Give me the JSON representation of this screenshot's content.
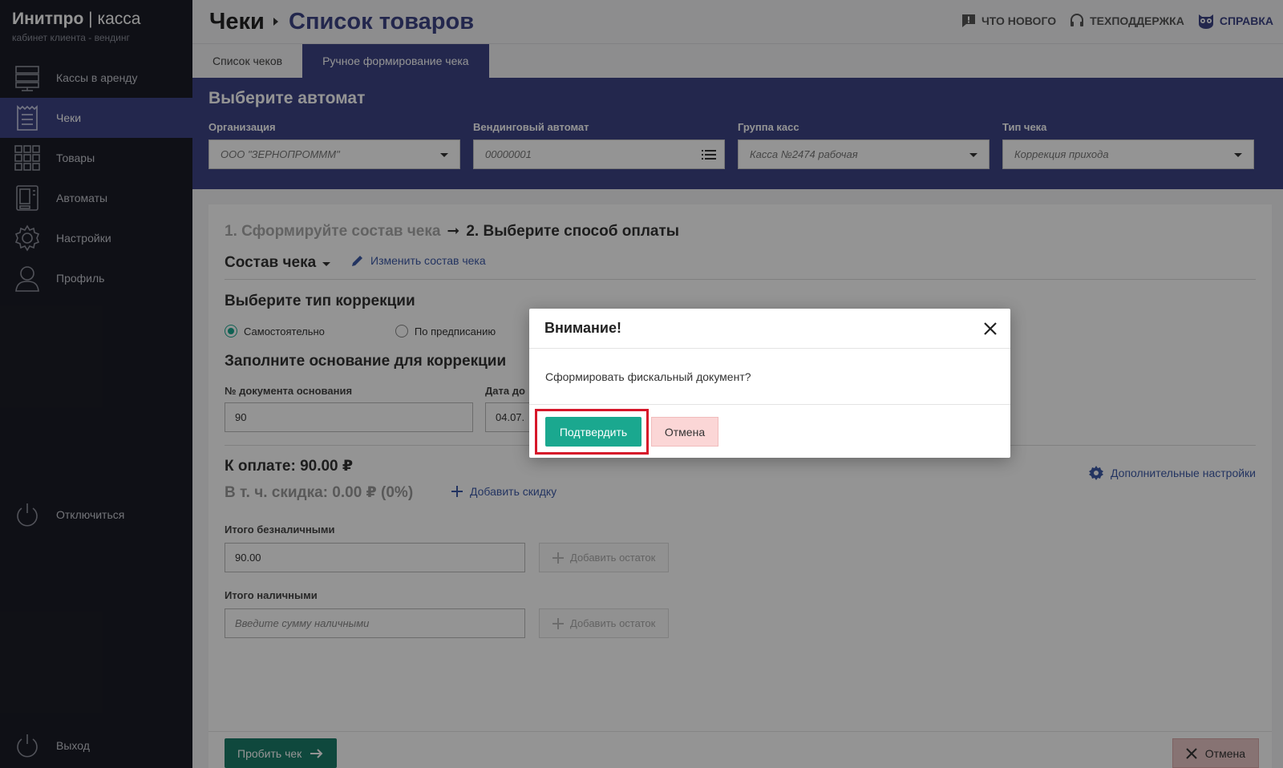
{
  "brand": {
    "name": "Инитпро",
    "separator": "|",
    "product": "касса",
    "subtitle": "кабинет клиента - вендинг"
  },
  "sidebar": {
    "items": [
      {
        "label": "Кассы в аренду",
        "icon": "server-icon"
      },
      {
        "label": "Чеки",
        "icon": "receipt-icon",
        "active": true
      },
      {
        "label": "Товары",
        "icon": "grid-icon"
      },
      {
        "label": "Автоматы",
        "icon": "vending-machine-icon"
      },
      {
        "label": "Настройки",
        "icon": "gear-icon"
      },
      {
        "label": "Профиль",
        "icon": "user-icon"
      }
    ],
    "disconnect": "Отключиться",
    "logout": "Выход"
  },
  "header": {
    "crumb_root": "Чеки",
    "crumb_current": "Список товаров",
    "links": {
      "whats_new": "ЧТО НОВОГО",
      "support": "ТЕХПОДДЕРЖКА",
      "help": "СПРАВКА"
    }
  },
  "tabs": [
    {
      "label": "Список чеков"
    },
    {
      "label": "Ручное формирование чека",
      "active": true
    }
  ],
  "filters": {
    "title": "Выберите автомат",
    "organization": {
      "label": "Организация",
      "value": "ООО \"ЗЕРНОПРОМММ\""
    },
    "machine": {
      "label": "Вендинговый автомат",
      "value": "00000001"
    },
    "group": {
      "label": "Группа касс",
      "value": "Касса №2474 рабочая"
    },
    "receipt_type": {
      "label": "Тип чека",
      "value": "Коррекция прихода"
    }
  },
  "main": {
    "step1": "1. Сформируйте состав чека",
    "step_arrow": "➞",
    "step2": "2. Выберите способ оплаты",
    "composition": "Состав чека",
    "edit_composition": "Изменить состав чека",
    "correction_title": "Выберите тип коррекции",
    "correction_options": [
      {
        "label": "Самостоятельно",
        "selected": true
      },
      {
        "label": "По предписанию",
        "selected": false
      }
    ],
    "basis_title": "Заполните основание для коррекции",
    "doc_number_label": "№ документа основания",
    "doc_number_value": "90",
    "date_label": "Дата до",
    "date_value": "04.07.",
    "to_pay": "К оплате: 90.00 ₽",
    "discount": "В т. ч. скидка: 0.00 ₽ (0%)",
    "add_discount": "Добавить скидку",
    "extra_settings": "Дополнительные настройки",
    "cashless_label": "Итого безналичными",
    "cashless_value": "90.00",
    "cash_label": "Итого наличными",
    "cash_placeholder": "Введите сумму наличными",
    "add_remainder": "Добавить остаток",
    "submit": "Пробить чек",
    "cancel": "Отмена"
  },
  "modal": {
    "title": "Внимание!",
    "message": "Сформировать фискальный документ?",
    "confirm": "Подтвердить",
    "cancel": "Отмена"
  },
  "colors": {
    "accent": "#3d4486",
    "sidebar": "#1b1d26",
    "confirm": "#1aa88f",
    "highlight": "#d6172a"
  }
}
